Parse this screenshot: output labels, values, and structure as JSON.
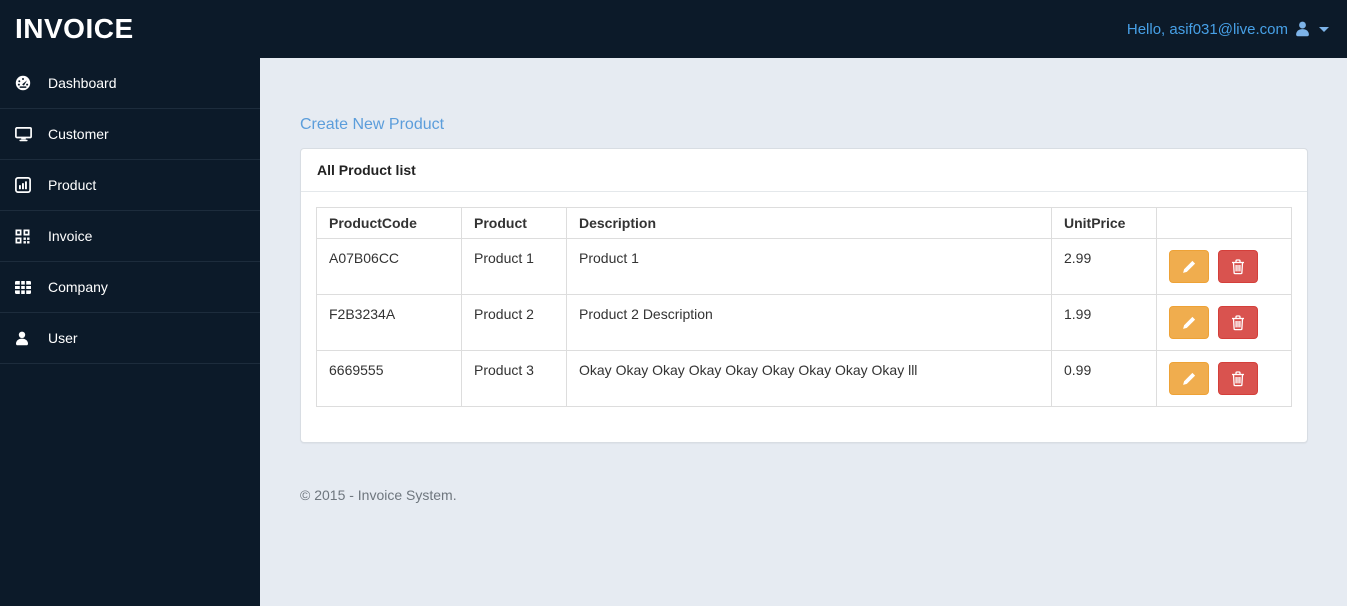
{
  "app": {
    "brand": "INVOICE"
  },
  "topbar": {
    "greeting": "Hello, asif031@live.com",
    "user_icon": "user-icon",
    "caret_icon": "caret-down-icon"
  },
  "sidebar": {
    "items": [
      {
        "label": "Dashboard",
        "icon": "dashboard-gauge-icon"
      },
      {
        "label": "Customer",
        "icon": "desktop-icon"
      },
      {
        "label": "Product",
        "icon": "bar-chart-icon"
      },
      {
        "label": "Invoice",
        "icon": "qrcode-icon"
      },
      {
        "label": "Company",
        "icon": "table-grid-icon"
      },
      {
        "label": "User",
        "icon": "person-icon"
      }
    ]
  },
  "content": {
    "create_link": "Create New Product",
    "panel": {
      "title": "All Product list",
      "table": {
        "headers": [
          "ProductCode",
          "Product",
          "Description",
          "UnitPrice",
          ""
        ],
        "rows": [
          {
            "product_code": "A07B06CC",
            "product": "Product 1",
            "description": "Product 1",
            "unit_price": "2.99"
          },
          {
            "product_code": "F2B3234A",
            "product": "Product 2",
            "description": "Product 2 Description",
            "unit_price": "1.99"
          },
          {
            "product_code": "6669555",
            "product": "Product 3",
            "description": "Okay Okay Okay Okay Okay Okay Okay Okay Okay lll",
            "unit_price": "0.99"
          }
        ],
        "row_actions": {
          "edit_icon": "pencil-icon",
          "delete_icon": "trash-icon"
        }
      }
    },
    "footer": "© 2015 - Invoice System."
  },
  "colors": {
    "navbar_bg": "#0c1a29",
    "page_bg": "#e6ebf2",
    "link_blue": "#5b9ddb",
    "topbar_link_blue": "#47a0e6",
    "edit_button": "#f0ad4e",
    "delete_button": "#d9534f"
  }
}
